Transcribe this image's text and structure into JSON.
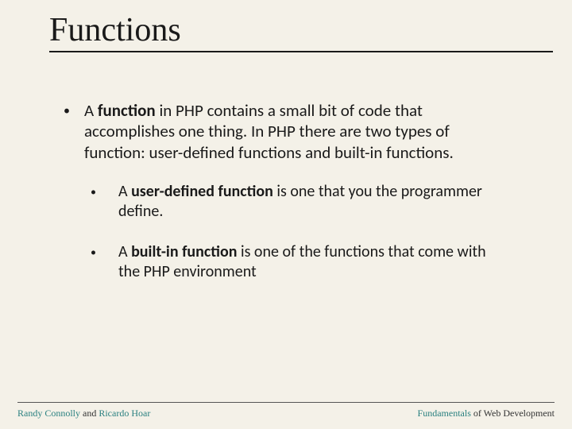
{
  "title": "Functions",
  "main_bullet": {
    "prefix": "A ",
    "bold": "function",
    "rest": " in PHP contains a small bit of code that accomplishes one thing. In PHP there are two types of function: user-defined functions and built-in functions."
  },
  "sub_bullets": [
    {
      "prefix": "A ",
      "bold": "user-defined function",
      "rest": " is one that you the programmer define."
    },
    {
      "prefix": "A ",
      "bold": "built-in function",
      "rest": " is one of the functions that come with the PHP environment"
    }
  ],
  "footer": {
    "left_name1": "Randy Connolly",
    "left_and": " and ",
    "left_name2": "Ricardo Hoar",
    "right_word1": "Fundamentals",
    "right_rest": " of Web Development"
  }
}
